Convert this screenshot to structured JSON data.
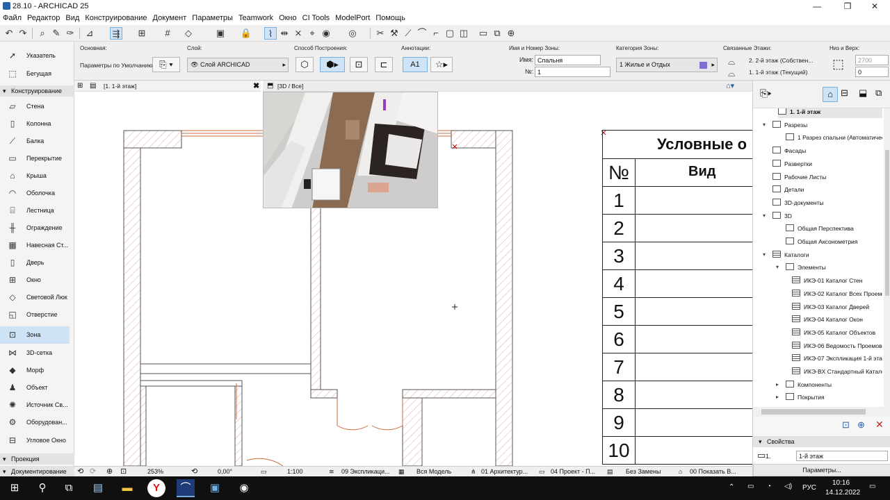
{
  "window": {
    "title": "28.10 - ARCHICAD 25",
    "controls": [
      "—",
      "❐",
      "✕"
    ]
  },
  "menu": [
    "Файл",
    "Редактор",
    "Вид",
    "Конструирование",
    "Документ",
    "Параметры",
    "Teamwork",
    "Окно",
    "CI Tools",
    "ModelPort",
    "Помощь"
  ],
  "toolbox": {
    "pointer": "Указатель",
    "marquee": "Бегущая Рамка",
    "section_design": "Конструирование",
    "tools": [
      "Стена",
      "Колонна",
      "Балка",
      "Перекрытие",
      "Крыша",
      "Оболочка",
      "Лестница",
      "Ограждение",
      "Навесная Ст...",
      "Дверь",
      "Окно",
      "Световой Люк",
      "Отверстие",
      "Зона",
      "3D-сетка",
      "Морф",
      "Объект",
      "Источник Св...",
      "Оборудован...",
      "Угловое Окно"
    ],
    "selected_tool": "Зона",
    "section_projection": "Проекция",
    "section_docs": "Документирование"
  },
  "infobox": {
    "basic_label": "Основная:",
    "basic_value": "Параметры по Умолчанию",
    "layer_label": "Слой:",
    "layer_value": "Слой ARCHICAD",
    "method_label": "Способ Построения:",
    "annot_label": "Аннотации:",
    "annot_value": "A1",
    "zone_name_label": "Имя и Номер Зоны:",
    "name_label": "Имя:",
    "name_value": "Спальня",
    "num_label": "№:",
    "num_value": "1",
    "zone_cat_label": "Категория Зоны:",
    "zone_cat_value": "1    Жилье и Отдых",
    "zone_cat_color": "#7f6ed6",
    "linked_label": "Связанные Этажи:",
    "linked_top": "2. 2-й этаж (Собствен...",
    "linked_bottom": "1. 1-й этаж (Текущий)",
    "botop_label": "Низ и Верх:",
    "top_value": "2700",
    "bottom_value": "0"
  },
  "tabs": {
    "plan": "[1. 1-й этаж]",
    "view3d": "[3D / Все]"
  },
  "legend": {
    "title": "Условные о",
    "col_num": "№",
    "col_view": "Вид",
    "rows": [
      "1",
      "2",
      "3",
      "4",
      "5",
      "6",
      "7",
      "8",
      "9",
      "10"
    ]
  },
  "navigator": {
    "items": [
      {
        "label": "1. 1-й этаж",
        "bold": true
      },
      {
        "label": "Разрезы"
      },
      {
        "label": "1 Разрез спальни (Автоматическ"
      },
      {
        "label": "Фасады"
      },
      {
        "label": "Развертки"
      },
      {
        "label": "Рабочие Листы"
      },
      {
        "label": "Детали"
      },
      {
        "label": "3D-документы"
      },
      {
        "label": "3D"
      },
      {
        "label": "Общая Перспектива"
      },
      {
        "label": "Общая Аксонометрия"
      },
      {
        "label": "Каталоги"
      },
      {
        "label": "Элементы"
      },
      {
        "label": "ИКЭ-01 Каталог Стен"
      },
      {
        "label": "ИКЭ-02 Каталог Всех Проемо"
      },
      {
        "label": "ИКЭ-03 Каталог Дверей"
      },
      {
        "label": "ИКЭ-04 Каталог Окон"
      },
      {
        "label": "ИКЭ-05 Каталог Объектов"
      },
      {
        "label": "ИКЭ-06 Ведомость Проемов"
      },
      {
        "label": "ИКЭ-07 Экспликация 1-й этаж"
      },
      {
        "label": "ИКЭ-BX Стандартный Каталог"
      },
      {
        "label": "Компоненты"
      },
      {
        "label": "Покрытия"
      }
    ],
    "properties_label": "Свойства",
    "prop_id": "1.",
    "prop_value": "1-й этаж",
    "params_button": "Параметры..."
  },
  "status": {
    "zoom": "253%",
    "angle": "0,00°",
    "scale": "1:100",
    "layer_combo": "09 Экспликаци...",
    "model": "Вся Модель",
    "pen_set": "01 Архитектур...",
    "mvo": "04 Проект - П...",
    "override": "Без Замены",
    "renovation": "00 Показать В..."
  },
  "taskbar": {
    "lang": "РУС",
    "time": "10:16",
    "date": "14.12.2022"
  }
}
